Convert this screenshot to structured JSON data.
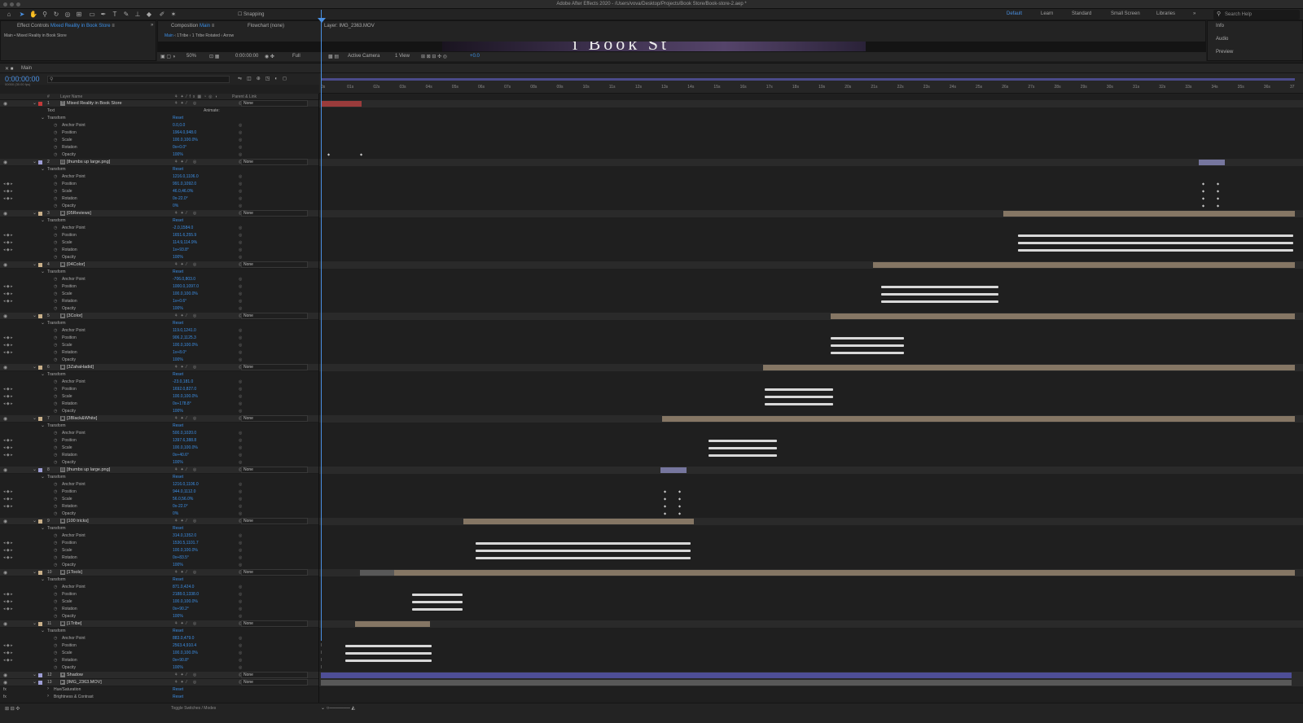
{
  "window_title": "Adobe After Effects 2020 - /Users/vova/Desktop/Projects/Book Store/Book-store-2.aep *",
  "toolbar": {
    "snapping_label": "Snapping",
    "workspaces": [
      "Default",
      "Learn",
      "Standard",
      "Small Screen",
      "Libraries"
    ],
    "active_workspace": "Default",
    "search_placeholder": "Search Help"
  },
  "effects_panel": {
    "tab_prefix": "Effect Controls",
    "tab_target": "Mixed Reality in Book Store",
    "breadcrumb": "Main • Mixed Reality in Book Store"
  },
  "comp_panel": {
    "tab_prefix": "Composition",
    "tab_target": "Main",
    "flowchart_tab": "Flowchart (none)",
    "layer_tab": "Layer: IMG_2363.MOV",
    "crumbs": [
      "Main",
      "1Tribe",
      "1 Tribe Rotated",
      "Arrow"
    ],
    "viewer_text": "i Book St",
    "zoom": "50%",
    "time": "0:00:00:00",
    "resolution": "Full",
    "camera": "Active Camera",
    "view": "1 View",
    "exposure": "+0.0"
  },
  "right_panel": {
    "items": [
      "Info",
      "Audio",
      "Preview"
    ]
  },
  "timeline": {
    "tab": "Main",
    "timecode": "0:00:00:00",
    "fps": "00000 (30.00 fps)",
    "col_layer_name": "Layer Name",
    "col_parent": "Parent & Link",
    "col_num": "#",
    "ticks": [
      "0s",
      "01s",
      "02s",
      "03s",
      "04s",
      "05s",
      "06s",
      "07s",
      "08s",
      "09s",
      "10s",
      "11s",
      "12s",
      "13s",
      "14s",
      "15s",
      "16s",
      "17s",
      "18s",
      "19s",
      "20s",
      "21s",
      "22s",
      "23s",
      "24s",
      "25s",
      "26s",
      "27s",
      "28s",
      "29s",
      "30s",
      "31s",
      "32s",
      "33s",
      "34s",
      "35s",
      "36s",
      "37"
    ],
    "toggle_label": "Toggle Switches / Modes"
  },
  "layers": [
    {
      "num": "1",
      "name": "Mixed Reality in Book Store",
      "type": "T",
      "color": "#c43a3a",
      "parent": "None",
      "text_label": "Text",
      "animate": "Animate:",
      "props": [
        [
          "Anchor Point",
          "0.0,0.0"
        ],
        [
          "Position",
          "1964.0,948.0"
        ],
        [
          "Scale",
          "100.0,100.0%"
        ],
        [
          "Rotation",
          "0x+0.0°"
        ],
        [
          "Opacity",
          "100%"
        ]
      ]
    },
    {
      "num": "2",
      "name": "[thumbs up large.png]",
      "type": "img",
      "color": "#9e9ed6",
      "parent": "None",
      "props": [
        [
          "Anchor Point",
          "1216.0,1106.0"
        ],
        [
          "Position",
          "991.0,1092.0"
        ],
        [
          "Scale",
          "46.0,46.0%"
        ],
        [
          "Rotation",
          "0x-22.0°"
        ],
        [
          "Opacity",
          "0%"
        ]
      ]
    },
    {
      "num": "3",
      "name": "[05Reviews]",
      "type": "comp",
      "color": "#c9b08a",
      "parent": "None",
      "props": [
        [
          "Anchor Point",
          "-2.0,1584.0"
        ],
        [
          "Position",
          "1651.6,255.9"
        ],
        [
          "Scale",
          "114.9,114.9%"
        ],
        [
          "Rotation",
          "1x+93.8°"
        ],
        [
          "Opacity",
          "100%"
        ]
      ]
    },
    {
      "num": "4",
      "name": "[04Color]",
      "type": "comp",
      "color": "#c9b08a",
      "parent": "None",
      "props": [
        [
          "Anchor Point",
          "-706.0,803.0"
        ],
        [
          "Position",
          "1000.0,1097.0"
        ],
        [
          "Scale",
          "100.0,100.0%"
        ],
        [
          "Rotation",
          "1x+0.6°"
        ],
        [
          "Opacity",
          "100%"
        ]
      ]
    },
    {
      "num": "5",
      "name": "[3Color]",
      "type": "comp",
      "color": "#c9b08a",
      "parent": "None",
      "props": [
        [
          "Anchor Point",
          "119.0,1241.0"
        ],
        [
          "Position",
          "906.2,1125.3"
        ],
        [
          "Scale",
          "100.0,100.0%"
        ],
        [
          "Rotation",
          "1x+8.0°"
        ],
        [
          "Opacity",
          "100%"
        ]
      ]
    },
    {
      "num": "6",
      "name": "[3ZahaHadid]",
      "type": "comp",
      "color": "#c9b08a",
      "parent": "None",
      "props": [
        [
          "Anchor Point",
          "-23.0,181.0"
        ],
        [
          "Position",
          "1692.0,827.0"
        ],
        [
          "Scale",
          "100.0,100.0%"
        ],
        [
          "Rotation",
          "0x+178.8°"
        ],
        [
          "Opacity",
          "100%"
        ]
      ]
    },
    {
      "num": "7",
      "name": "[3Black&White]",
      "type": "comp",
      "color": "#c9b08a",
      "parent": "None",
      "props": [
        [
          "Anchor Point",
          "500.0,1020.0"
        ],
        [
          "Position",
          "1397.6,388.8"
        ],
        [
          "Scale",
          "100.0,100.0%"
        ],
        [
          "Rotation",
          "0x+40.6°"
        ],
        [
          "Opacity",
          "100%"
        ]
      ]
    },
    {
      "num": "8",
      "name": "[thumbs up large.png]",
      "type": "img",
      "color": "#9e9ed6",
      "parent": "None",
      "props": [
        [
          "Anchor Point",
          "1216.0,1106.0"
        ],
        [
          "Position",
          "944.0,1112.0"
        ],
        [
          "Scale",
          "56.0,56.0%"
        ],
        [
          "Rotation",
          "0x-22.0°"
        ],
        [
          "Opacity",
          "0%"
        ]
      ]
    },
    {
      "num": "9",
      "name": "[100 tricks]",
      "type": "comp",
      "color": "#c9b08a",
      "parent": "None",
      "props": [
        [
          "Anchor Point",
          "314.0,1352.0"
        ],
        [
          "Position",
          "1530.5,1101.7"
        ],
        [
          "Scale",
          "100.0,100.0%"
        ],
        [
          "Rotation",
          "0x+83.5°"
        ],
        [
          "Opacity",
          "100%"
        ]
      ]
    },
    {
      "num": "10",
      "name": "[1Tools]",
      "type": "comp",
      "color": "#c9b08a",
      "parent": "None",
      "props": [
        [
          "Anchor Point",
          "871.0,424.0"
        ],
        [
          "Position",
          "2188.0,1338.0"
        ],
        [
          "Scale",
          "100.0,100.0%"
        ],
        [
          "Rotation",
          "0x+90.2°"
        ],
        [
          "Opacity",
          "100%"
        ]
      ]
    },
    {
      "num": "11",
      "name": "[1Tribe]",
      "type": "comp",
      "color": "#c9b08a",
      "parent": "None",
      "props": [
        [
          "Anchor Point",
          "883.0,479.0"
        ],
        [
          "Position",
          "2563.4,910.4"
        ],
        [
          "Scale",
          "100.0,100.0%"
        ],
        [
          "Rotation",
          "0x+90.8°"
        ],
        [
          "Opacity",
          "100%"
        ]
      ]
    },
    {
      "num": "12",
      "name": "Shadow",
      "type": "star",
      "color": "#9e9ed6",
      "parent": "None",
      "props": []
    },
    {
      "num": "13",
      "name": "[IMG_2363.MOV]",
      "type": "vid",
      "color": "#9e9ed6",
      "parent": "None",
      "effects": [
        [
          "Hue/Saturation",
          "Reset"
        ],
        [
          "Brightness & Contrast",
          "Reset"
        ]
      ],
      "props": []
    }
  ],
  "labels": {
    "transform": "Transform",
    "reset": "Reset",
    "none": "None"
  },
  "colors": {
    "accent": "#3c8fe6",
    "comp_bar": "#857664",
    "layer_bg": "#2a2a2a"
  }
}
